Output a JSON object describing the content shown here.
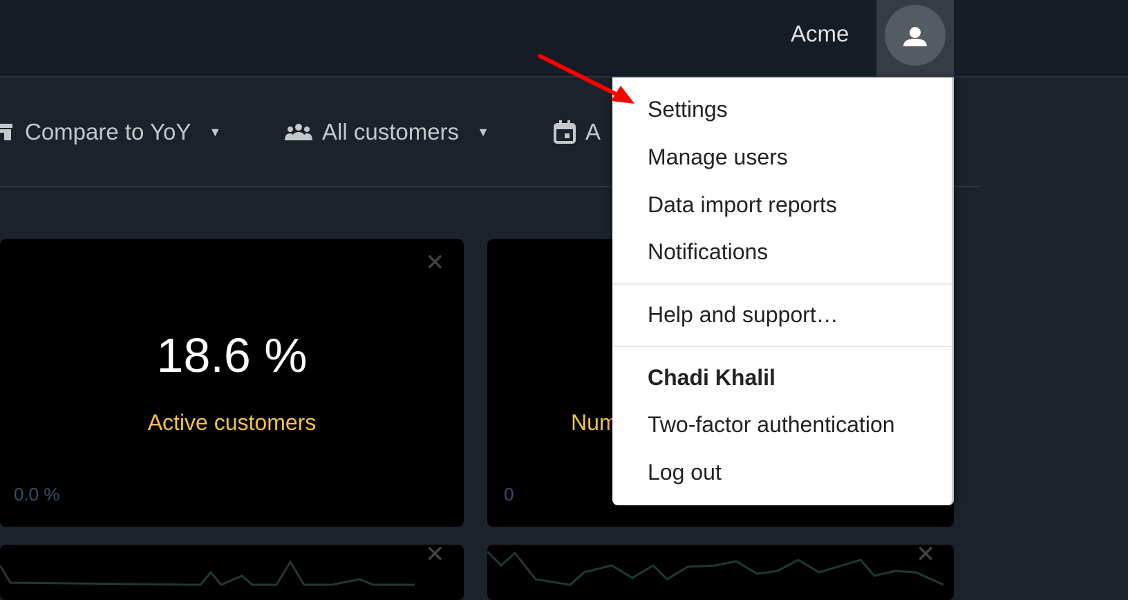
{
  "header": {
    "brand": "Acme",
    "avatar_icon": "user-icon"
  },
  "toolbar": {
    "items": [
      {
        "icon": "store-icon",
        "label": "Compare to YoY"
      },
      {
        "icon": "users-icon",
        "label": "All customers"
      },
      {
        "icon": "calendar-icon",
        "label": "A"
      }
    ]
  },
  "cards": [
    {
      "value": "18.6 %",
      "label": "Active customers",
      "sub": "0.0 %"
    },
    {
      "value": "",
      "label": "Num",
      "sub": "0"
    }
  ],
  "menu": {
    "items": [
      "Settings",
      "Manage users",
      "Data import reports",
      "Notifications"
    ],
    "help": "Help and support…",
    "user_name": "Chadi Khalil",
    "user_items": [
      "Two-factor authentication",
      "Log out"
    ]
  },
  "colors": {
    "accent": "#f2c14e",
    "annotation_arrow": "#ff0000",
    "sparkline": "#1f3a33"
  }
}
